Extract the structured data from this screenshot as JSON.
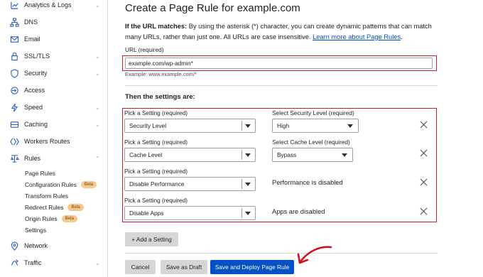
{
  "sidebar": {
    "items": [
      {
        "label": "Analytics & Logs",
        "icon": "chart-icon",
        "chevron": "⌄"
      },
      {
        "label": "DNS",
        "icon": "network-tree-icon",
        "chevron": ""
      },
      {
        "label": "Email",
        "icon": "envelope-icon",
        "chevron": ""
      },
      {
        "label": "SSL/TLS",
        "icon": "lock-icon",
        "chevron": "⌄"
      },
      {
        "label": "Security",
        "icon": "shield-icon",
        "chevron": "⌄"
      },
      {
        "label": "Access",
        "icon": "access-icon",
        "chevron": ""
      },
      {
        "label": "Speed",
        "icon": "lightning-icon",
        "chevron": "⌄"
      },
      {
        "label": "Caching",
        "icon": "drive-icon",
        "chevron": "⌄"
      },
      {
        "label": "Workers Routes",
        "icon": "workers-icon",
        "chevron": ""
      },
      {
        "label": "Rules",
        "icon": "rules-icon",
        "chevron": "⌃"
      }
    ],
    "rules_sub": [
      {
        "label": "Page Rules",
        "beta": ""
      },
      {
        "label": "Configuration Rules",
        "beta": "Beta"
      },
      {
        "label": "Transform Rules",
        "beta": ""
      },
      {
        "label": "Redirect Rules",
        "beta": "Beta"
      },
      {
        "label": "Origin Rules",
        "beta": "Beta"
      },
      {
        "label": "Settings",
        "beta": ""
      }
    ],
    "bottom": [
      {
        "label": "Network",
        "icon": "pin-icon",
        "chevron": ""
      },
      {
        "label": "Traffic",
        "icon": "traffic-icon",
        "chevron": "⌄"
      }
    ]
  },
  "main": {
    "title": "Create a Page Rule for example.com",
    "intro_bold": "If the URL matches:",
    "intro_text": " By using the asterisk (*) character, you can create dynamic patterns that can match many URLs, rather than just one. All URLs are case insensitive. ",
    "intro_link": "Learn more about Page Rules",
    "intro_end": ".",
    "url_label": "URL (required)",
    "url_value": "example.com/wp-admin*",
    "url_example": "Example: www.example.com/*",
    "settings_heading": "Then the settings are:",
    "rows": [
      {
        "pick_label": "Pick a Setting (required)",
        "pick_value": "Security Level",
        "right_label": "Select Security Level (required)",
        "right_value": "High",
        "right_text": ""
      },
      {
        "pick_label": "Pick a Setting (required)",
        "pick_value": "Cache Level",
        "right_label": "Select Cache Level (required)",
        "right_value": "Bypass",
        "right_text": ""
      },
      {
        "pick_label": "Pick a Setting (required)",
        "pick_value": "Disable Performance",
        "right_label": "",
        "right_value": "",
        "right_text": "Performance is disabled"
      },
      {
        "pick_label": "Pick a Setting (required)",
        "pick_value": "Disable Apps",
        "right_label": "",
        "right_value": "",
        "right_text": "Apps are disabled"
      }
    ],
    "add_setting": "+ Add a Setting",
    "cancel": "Cancel",
    "save_draft": "Save as Draft",
    "save_deploy": "Save and Deploy Page Rule"
  },
  "colors": {
    "accent": "#0051c3",
    "highlight": "#c9202d",
    "beta_badge": "#f6c88a"
  }
}
